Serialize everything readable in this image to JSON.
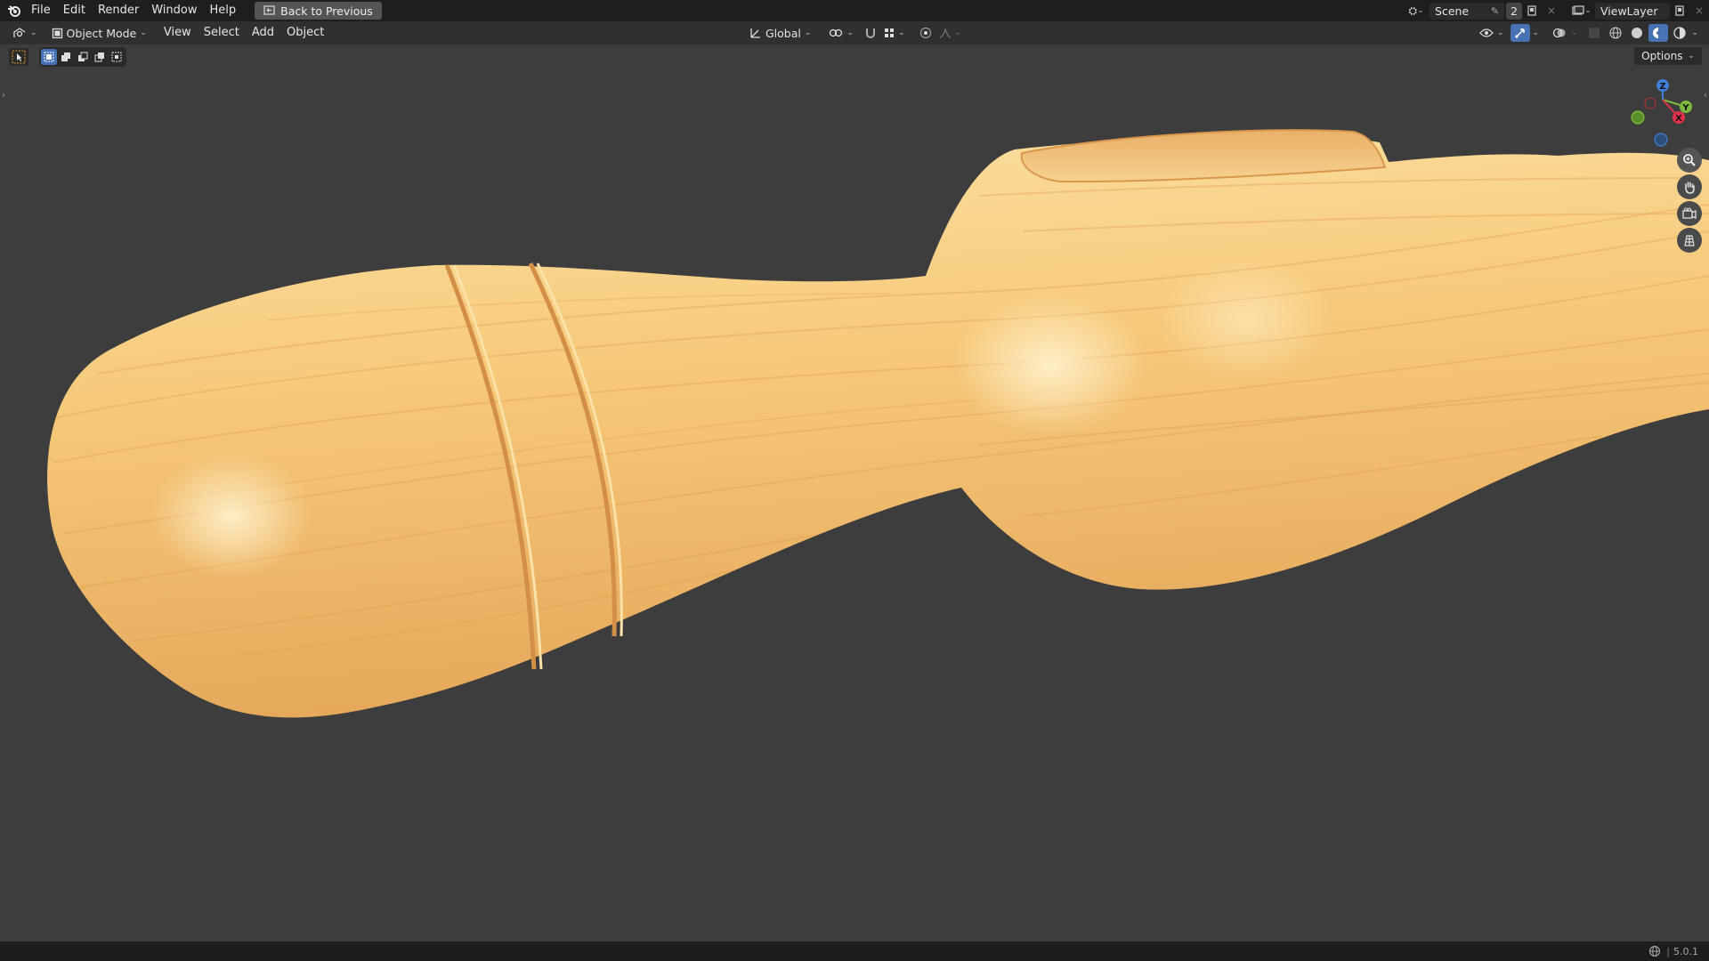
{
  "topbar": {
    "menu": [
      "File",
      "Edit",
      "Render",
      "Window",
      "Help"
    ],
    "back_button": "Back to Previous",
    "scene_label": "Scene",
    "scene_users": "2",
    "view_layer_label": "ViewLayer"
  },
  "header": {
    "mode": "Object Mode",
    "menu": [
      "View",
      "Select",
      "Add",
      "Object"
    ],
    "transform_orientation": "Global"
  },
  "toolbar": {
    "options_label": "Options"
  },
  "gizmo": {
    "z": "Z",
    "y": "Y",
    "x": "X"
  },
  "status": {
    "version": "5.0.1"
  },
  "colors": {
    "background": "#3d3d3d",
    "wood_light": "#fbd590",
    "wood_dark": "#e9ae5a",
    "active_blue": "#4772b3",
    "axis_x": "#e0334b",
    "axis_y": "#7eb93b",
    "axis_z": "#3b80d6"
  },
  "icons": [
    "blender-logo-icon",
    "back-icon",
    "editor-type-icon",
    "object-mode-icon",
    "orientation-icon",
    "pivot-icon",
    "snap-icon",
    "snap-increment-icon",
    "proportional-icon",
    "falloff-icon",
    "visibility-icon",
    "gizmo-icon",
    "overlay-icon",
    "xray-icon",
    "wireframe-shading-icon",
    "solid-shading-icon",
    "material-shading-icon",
    "rendered-shading-icon",
    "select-tool-icon",
    "zoom-icon",
    "hand-icon",
    "camera-icon",
    "grid-icon",
    "globe-icon"
  ]
}
